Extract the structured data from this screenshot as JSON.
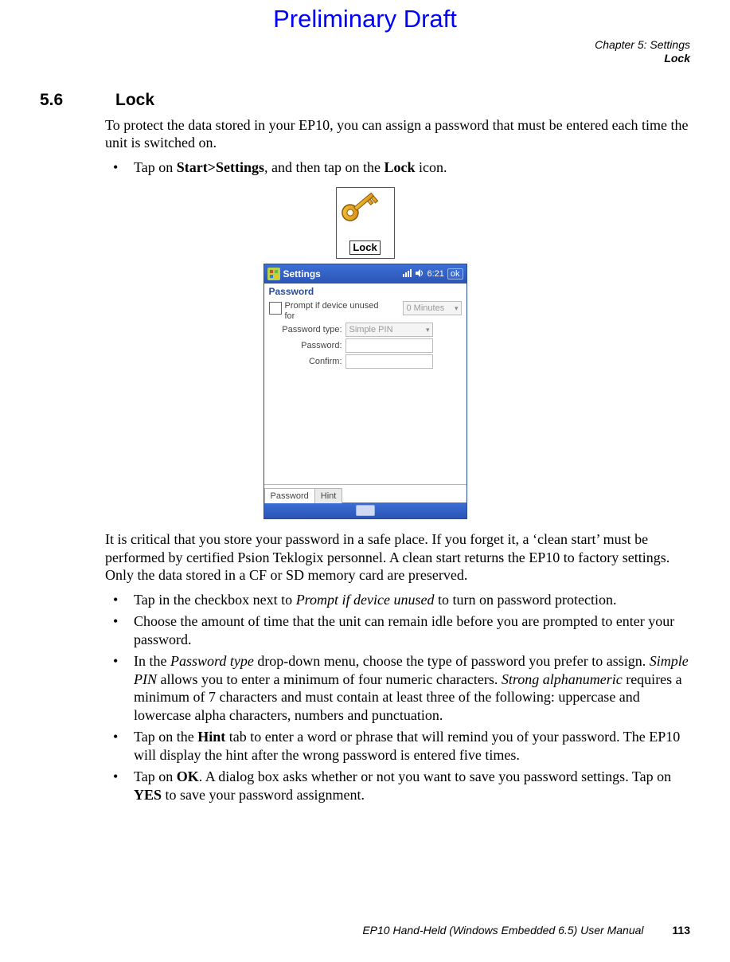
{
  "header": {
    "draft": "Preliminary Draft",
    "chapter": "Chapter 5:  Settings",
    "sub": "Lock"
  },
  "section": {
    "number": "5.6",
    "title": "Lock"
  },
  "intro": "To protect the data stored in your EP10, you can assign a password that must be entered each time the unit is switched on.",
  "bullets_top": [
    {
      "pre": "Tap on ",
      "b1": "Start>Settings",
      "mid": ", and then tap on the ",
      "b2": "Lock",
      "post": " icon."
    }
  ],
  "lock_icon_label": "Lock",
  "pda": {
    "title": "Settings",
    "time": "6:21",
    "ok": "ok",
    "subheader": "Password",
    "prompt_label_l1": "Prompt if device unused",
    "prompt_label_l2": "for",
    "prompt_value": "0 Minutes",
    "rows": {
      "password_type_label": "Password type:",
      "password_type_value": "Simple PIN",
      "password_label": "Password:",
      "confirm_label": "Confirm:"
    },
    "tabs": {
      "password": "Password",
      "hint": "Hint"
    }
  },
  "para2": "It is critical that you store your password in a safe place. If you forget it, a ‘clean start’ must be performed by certified Psion Teklogix personnel. A clean start returns the EP10 to factory settings. Only the data stored in a CF or SD memory card are preserved.",
  "bullets_bottom": [
    {
      "html": "Tap in the checkbox next to <i>Prompt if device unused</i> to turn on password protection."
    },
    {
      "html": "Choose the amount of time that the unit can remain idle before you are prompted to enter your password."
    },
    {
      "html": "In the <i>Password type</i> drop-down menu, choose the type of password you prefer to assign. <i>Simple PIN</i> allows you to enter a minimum of four numeric characters. <i>Strong alphanumeric</i> requires a minimum of 7 characters and must contain at least three of the following: uppercase and lowercase alpha characters, numbers and punctuation."
    },
    {
      "html": "Tap on the <b>Hint</b> tab to enter a word or phrase that will remind you of your password. The EP10 will display the hint after the wrong password is entered five times."
    },
    {
      "html": "Tap on <b>OK</b>. A dialog box asks whether or not you want to save you password settings. Tap on <b>YES</b> to save your password assignment."
    }
  ],
  "footer": {
    "manual": "EP10 Hand-Held (Windows Embedded 6.5) User Manual",
    "page": "113"
  }
}
